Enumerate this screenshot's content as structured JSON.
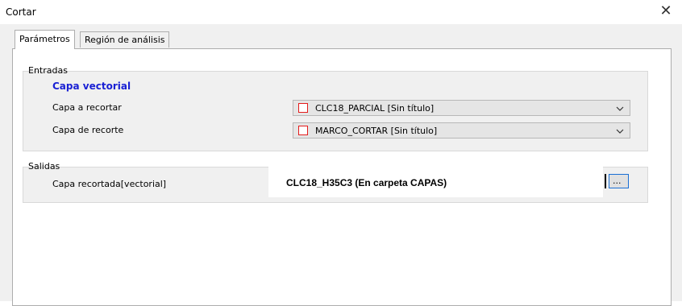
{
  "window": {
    "title": "Cortar",
    "close_icon": "close-icon"
  },
  "tabs": [
    {
      "label": "Parámetros",
      "active": true
    },
    {
      "label": "Región de análisis",
      "active": false
    }
  ],
  "inputs_group": {
    "label": "Entradas",
    "section_title": "Capa vectorial",
    "rows": [
      {
        "label": "Capa a recortar",
        "value": "CLC18_PARCIAL [Sin título]"
      },
      {
        "label": "Capa de recorte",
        "value": "MARCO_CORTAR [Sin título]"
      }
    ]
  },
  "outputs_group": {
    "label": "Salidas",
    "row_label": "Capa recortada[vectorial]",
    "value": "CLC18_H35C3 (En carpeta CAPAS)",
    "browse_label": "..."
  },
  "colors": {
    "section_title": "#1a21d4",
    "layer_icon": "#e31b1b",
    "browse_border": "#1a6fd4"
  }
}
